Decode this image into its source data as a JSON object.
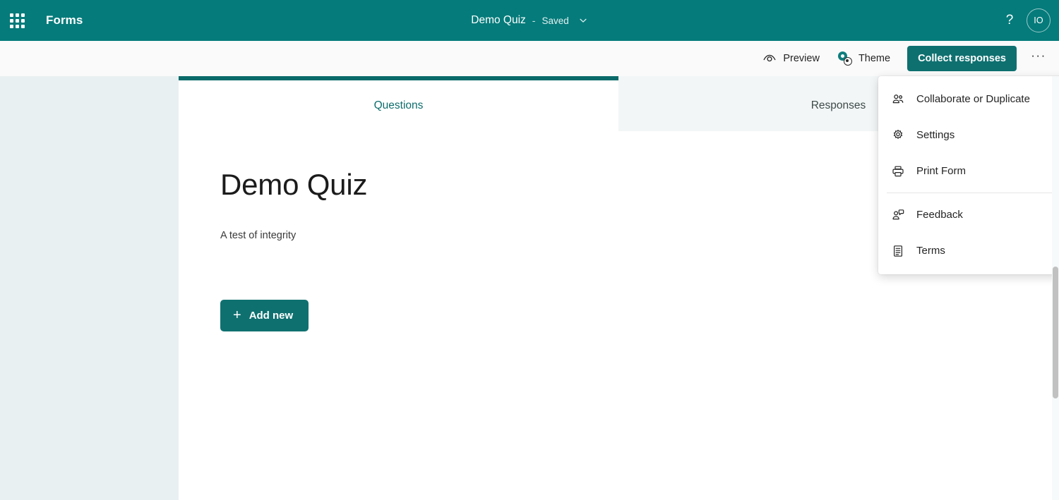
{
  "header": {
    "waffle_label": "app-launcher",
    "app_name": "Forms",
    "doc_title": "Demo Quiz",
    "separator": "-",
    "save_status": "Saved",
    "chevron_icon": "chevron-down-icon",
    "help_label": "?",
    "avatar_initials": "IO"
  },
  "toolbar": {
    "preview_label": "Preview",
    "preview_icon": "eye-icon",
    "theme_label": "Theme",
    "theme_icon": "palette-icon",
    "collect_responses_label": "Collect responses",
    "more_label": "···",
    "more_icon": "ellipsis-icon"
  },
  "tabs": [
    {
      "label": "Questions",
      "active": true
    },
    {
      "label": "Responses",
      "active": false
    }
  ],
  "form": {
    "title": "Demo Quiz",
    "subtitle": "A test of integrity",
    "add_new_label": "Add new",
    "add_new_icon": "plus-icon"
  },
  "overflow_menu": {
    "items": [
      {
        "label": "Collaborate or Duplicate",
        "icon": "people-icon"
      },
      {
        "label": "Settings",
        "icon": "gear-icon"
      },
      {
        "label": "Print Form",
        "icon": "printer-icon"
      },
      {
        "label": "Feedback",
        "icon": "person-feedback-icon"
      },
      {
        "label": "Terms",
        "icon": "document-list-icon"
      }
    ],
    "divider_after_index": 2
  },
  "colors": {
    "brand_teal": "#057b7b",
    "button_teal": "#0f7070",
    "tab_active_border": "#0a6a6a",
    "page_background": "#e9f0f1",
    "card_background": "#ffffff",
    "toolbar_background": "#fafafa"
  }
}
